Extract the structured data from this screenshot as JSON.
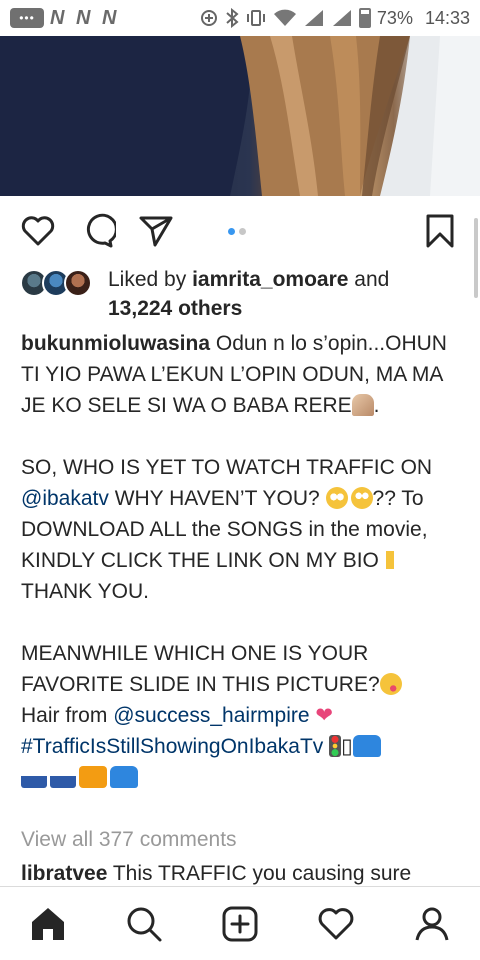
{
  "status_bar": {
    "battery": "73%",
    "time": "14:33",
    "notification_icons": [
      "messages-icon",
      "n-icon",
      "n-icon",
      "n-icon"
    ],
    "system_icons": [
      "data-saver-icon",
      "bluetooth-icon",
      "vibrate-icon",
      "wifi-icon",
      "signal-icon",
      "signal-icon",
      "battery-icon"
    ]
  },
  "post": {
    "carousel": {
      "count": 2,
      "active": 0
    },
    "likes": {
      "prefix": "Liked by ",
      "user": "iamrita_omoare",
      "and": " and",
      "others": "13,224 others"
    },
    "caption": {
      "username": "bukunmioluwasina",
      "text_1": " Odun n lo s’opin...OHUN TI YIO PAWA L’EKUN L’OPIN ODUN, MA MA JE KO SELE SI WA O BABA RERE",
      "text_1_end": ".",
      "text_2": "SO, WHO IS YET TO WATCH TRAFFIC ON ",
      "mention_1": "@ibakatv",
      "text_3": " WHY HAVEN’T YOU? ",
      "text_3_end": "?? To DOWNLOAD ALL the SONGS in the movie, KINDLY CLICK THE LINK ON MY BIO",
      "text_4": " THANK YOU.",
      "text_5": "MEANWHILE WHICH ONE IS YOUR FAVORITE SLIDE IN THIS PICTURE?",
      "text_6": "Hair from ",
      "mention_2": "@success_hairmpire",
      "hashtag": "#TrafficIsStillShowingOnIbakaTv",
      "missing_glyph": "▯"
    },
    "view_all": "View all 377 comments",
    "comment": {
      "username": "libratvee",
      "text": " This TRAFFIC you causing sure"
    }
  },
  "colors": {
    "link": "#003569",
    "carousel_active": "#3897f0",
    "muted": "#999999"
  }
}
